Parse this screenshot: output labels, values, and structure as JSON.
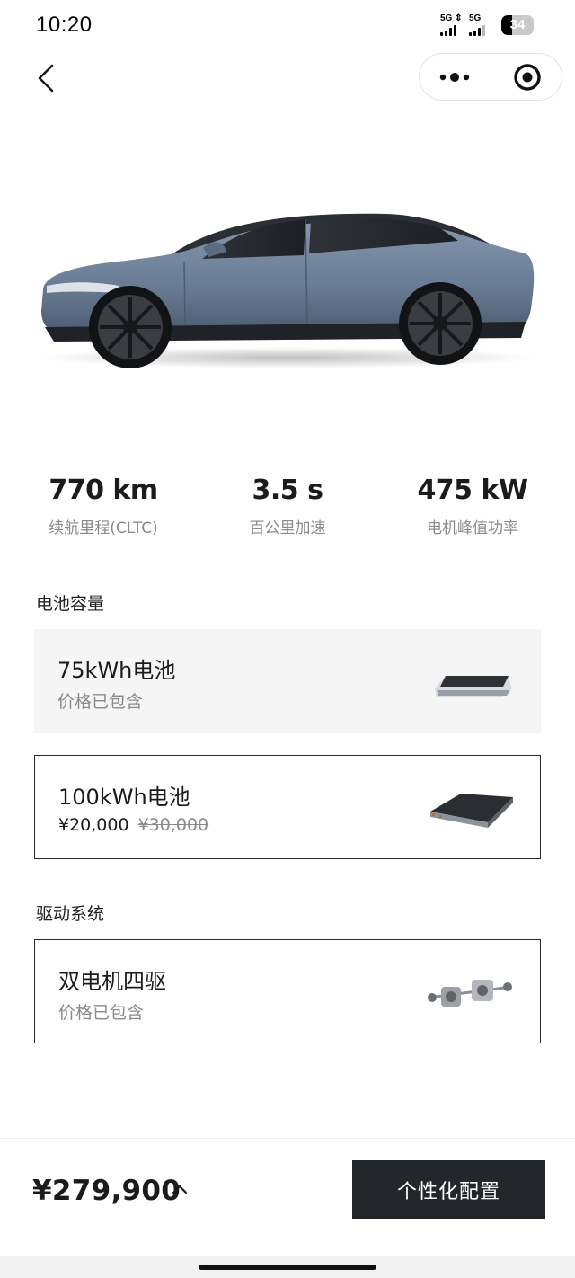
{
  "status_bar": {
    "time": "10:20",
    "signal_1_label": "5G",
    "signal_2_label": "5G",
    "battery": "34",
    "battery_level": 0.34
  },
  "nav": {
    "back_icon": "chevron-left-icon",
    "more_icon": "more-dots-icon",
    "close_icon": "target-close-icon"
  },
  "car_image": {
    "color": "#6a7c95"
  },
  "stats": [
    {
      "value": "770 km",
      "label": "续航里程(CLTC)"
    },
    {
      "value": "3.5 s",
      "label": "百公里加速"
    },
    {
      "value": "475 kW",
      "label": "电机峰值功率"
    }
  ],
  "battery_section": {
    "title": "电池容量",
    "options": [
      {
        "title": "75kWh电池",
        "subtitle": "价格已包含",
        "selected": false
      },
      {
        "title": "100kWh电池",
        "price": "¥20,000",
        "original_price": "¥30,000",
        "selected": true
      }
    ]
  },
  "drive_section": {
    "title": "驱动系统",
    "options": [
      {
        "title": "双电机四驱",
        "subtitle": "价格已包含",
        "selected": true
      }
    ]
  },
  "bottom_bar": {
    "total_price": "¥279,900",
    "toggle_icon": "chevron-up-icon",
    "button_label": "个性化配置"
  },
  "colors": {
    "button_bg": "#23262b",
    "muted_text": "#8a8a8a",
    "card_inactive_bg": "#f5f5f5"
  }
}
